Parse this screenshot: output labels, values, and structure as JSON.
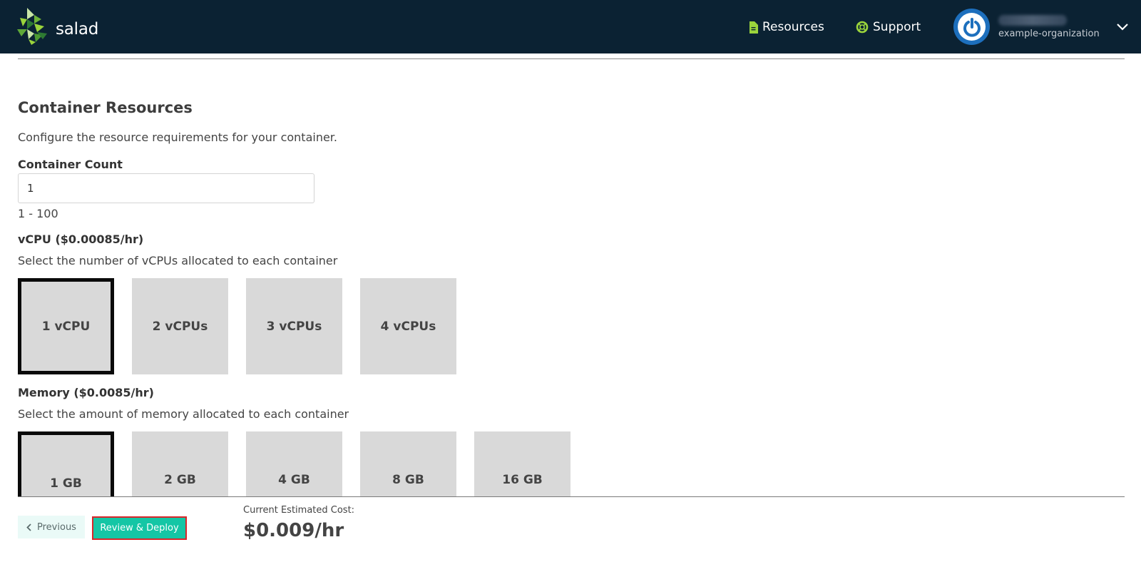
{
  "header": {
    "brand": "salad",
    "nav": {
      "resources_label": "Resources",
      "support_label": "Support"
    },
    "org_name": "example-organization",
    "icons": {
      "logo": "salad-logo-icon",
      "resources": "document-icon",
      "support": "lifebuoy-icon",
      "avatar": "power-icon",
      "account_menu": "chevron-down-icon"
    },
    "colors": {
      "bar": "#0b2233",
      "accent": "#9bd43c"
    }
  },
  "section": {
    "title": "Container Resources",
    "description": "Configure the resource requirements for your container."
  },
  "container_count": {
    "label": "Container Count",
    "value": "1",
    "hint": "1 - 100"
  },
  "vcpu": {
    "label": "vCPU ($0.00085/hr)",
    "description": "Select the number of vCPUs allocated to each container",
    "options": [
      "1 vCPU",
      "2 vCPUs",
      "3 vCPUs",
      "4 vCPUs"
    ],
    "selected": "1 vCPU"
  },
  "memory": {
    "label": "Memory ($0.0085/hr)",
    "description": "Select the amount of memory allocated to each container",
    "options": [
      "1 GB",
      "2 GB",
      "4 GB",
      "8 GB",
      "16 GB"
    ],
    "selected": "1 GB"
  },
  "footer": {
    "previous_label": "Previous",
    "deploy_label": "Review & Deploy",
    "cost_label": "Current Estimated Cost:",
    "cost_value": "$0.009/hr",
    "colors": {
      "deploy": "#14c6a5",
      "highlight_border": "#d8262a"
    }
  }
}
